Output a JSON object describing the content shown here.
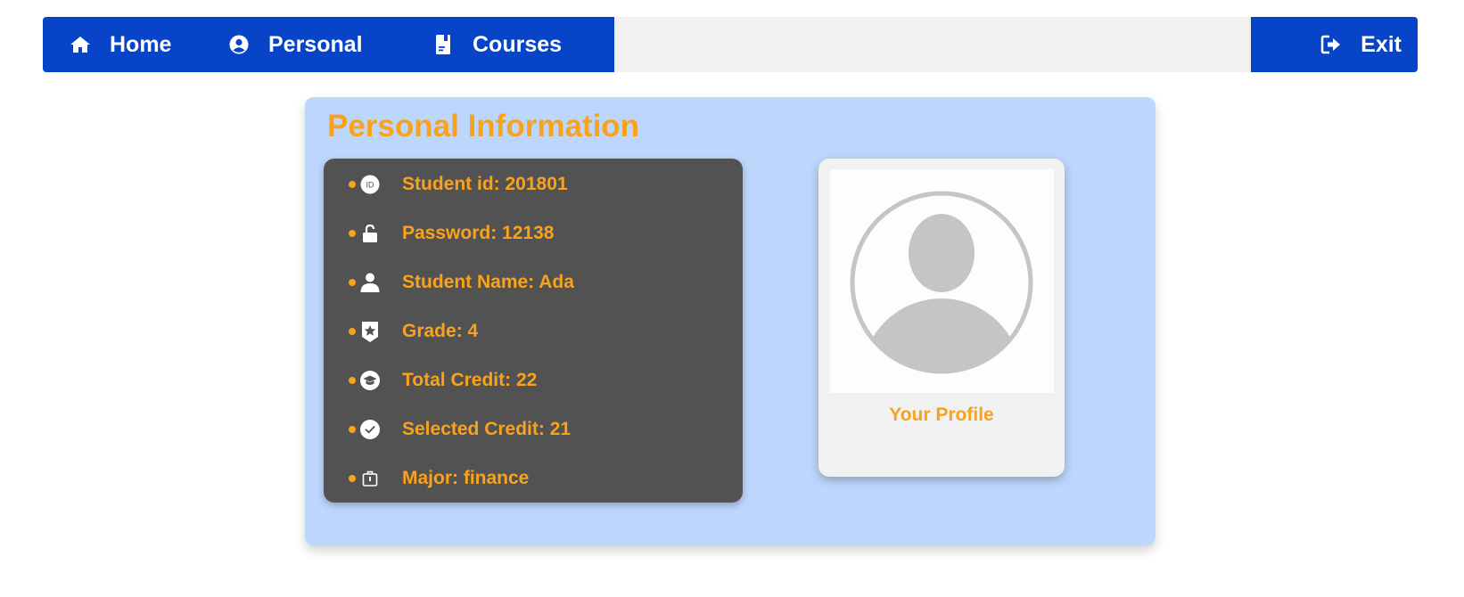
{
  "nav": {
    "items": [
      {
        "label": "Home",
        "icon": "home-icon"
      },
      {
        "label": "Personal",
        "icon": "user-circle-icon"
      },
      {
        "label": "Courses",
        "icon": "document-icon"
      }
    ],
    "exit_label": "Exit",
    "exit_icon": "sign-out-icon"
  },
  "colors": {
    "nav": "#0844c8",
    "accent": "#f9a21c",
    "card_bg": "#bdd6fc",
    "info_bg": "#525252",
    "profile_bg": "#f1f1f1"
  },
  "personal": {
    "title": "Personal Information",
    "fields": [
      {
        "text": "Student id: 201801",
        "icon": "id-icon"
      },
      {
        "text": "Password: 12138",
        "icon": "unlock-icon"
      },
      {
        "text": "Student Name: Ada",
        "icon": "user-icon"
      },
      {
        "text": "Grade: 4",
        "icon": "star-badge-icon"
      },
      {
        "text": "Total Credit: 22",
        "icon": "graduation-cap-icon"
      },
      {
        "text": "Selected Credit: 21",
        "icon": "check-circle-icon"
      },
      {
        "text": "Major: finance",
        "icon": "briefcase-icon"
      }
    ]
  },
  "profile": {
    "label": "Your Profile",
    "avatar_icon": "default-avatar-icon"
  }
}
